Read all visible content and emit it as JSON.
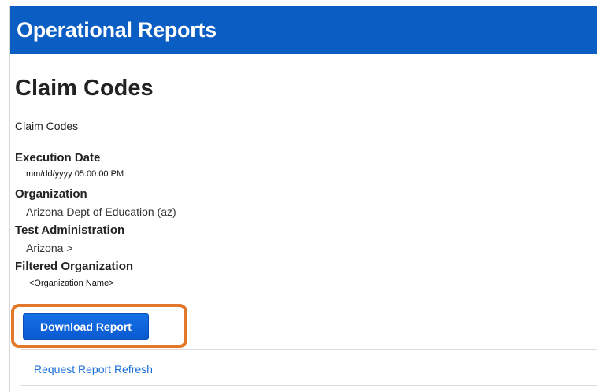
{
  "header": {
    "title": "Operational Reports"
  },
  "report": {
    "title": "Claim Codes",
    "description": "Claim Codes"
  },
  "fields": [
    {
      "label": "Execution Date",
      "value": "mm/dd/yyyy  05:00:00 PM"
    },
    {
      "label": "Organization",
      "value": "Arizona Dept of Education (az)"
    },
    {
      "label": "Test Administration",
      "value": "Arizona >"
    },
    {
      "label": "Filtered Organization",
      "value": "<Organization Name>"
    }
  ],
  "actions": {
    "download_label": "Download Report",
    "refresh_label": "Request Report Refresh"
  },
  "colors": {
    "header_bg": "#0a5dc2",
    "button_bg": "#1570e6",
    "highlight": "#e2792a",
    "link": "#1a6ed8"
  }
}
